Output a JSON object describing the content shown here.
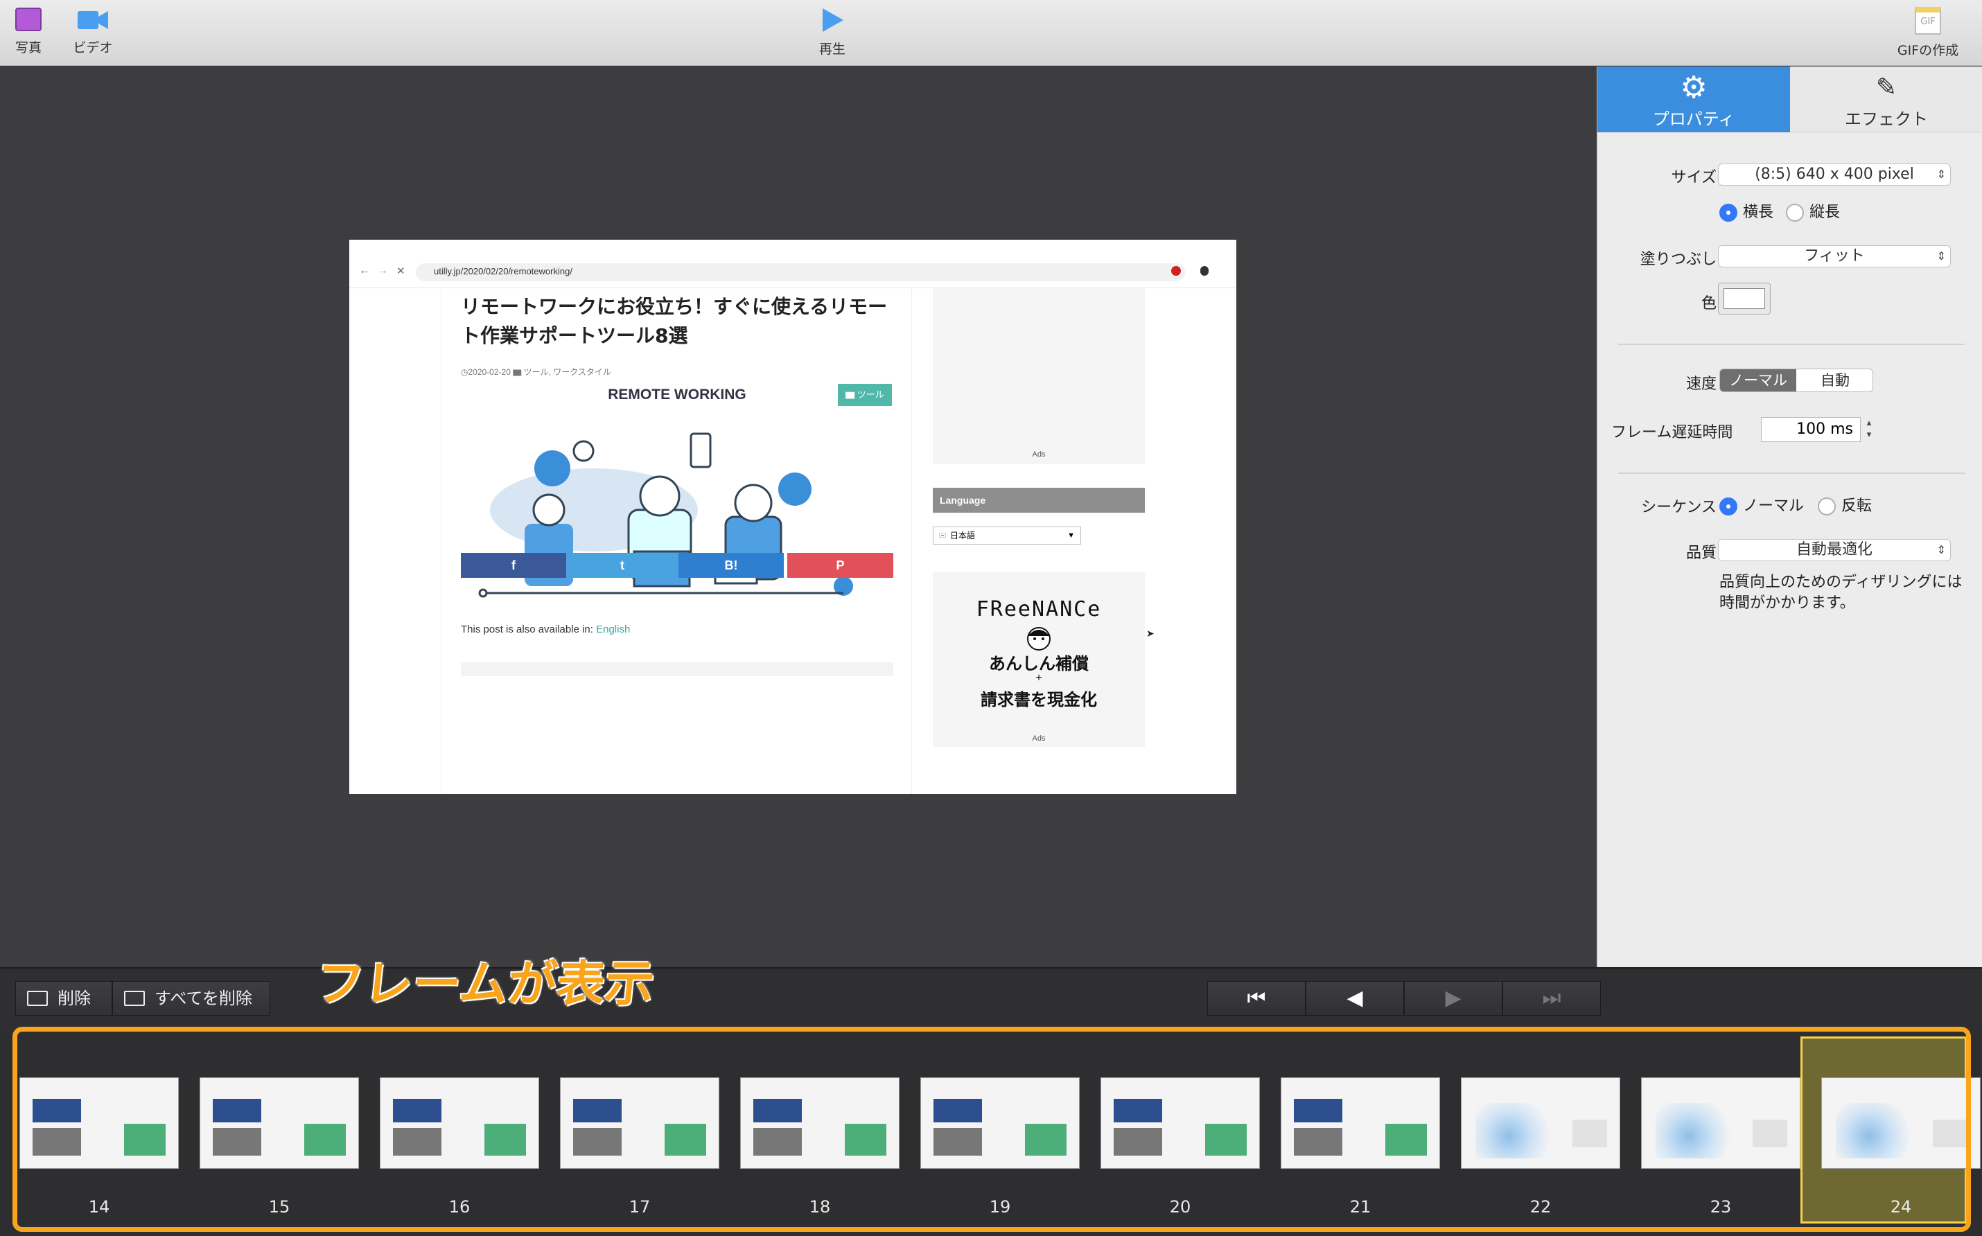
{
  "toolbar": {
    "photo_label": "写真",
    "video_label": "ビデオ",
    "play_label": "再生",
    "gif_label": "GIFの作成",
    "gif_icon_text": "GIF"
  },
  "preview": {
    "url": "utilly.jp/2020/02/20/remoteworking/",
    "article_title": "リモートワークにお役立ち！すぐに使えるリモート作業サポートツール8選",
    "date": "2020-02-20",
    "categories": "ツール, ワークスタイル",
    "category_badge": "ツール",
    "hero_heading": "REMOTE WORKING",
    "share_buttons": [
      "f",
      "t",
      "B!",
      "P"
    ],
    "also_available_text": "This post is also available in:",
    "also_available_link": "English",
    "ads_label": "Ads",
    "language_header": "Language",
    "language_value": "日本語",
    "freenance_brand": "FReeNANCe",
    "freenance_line1": "あんしん補償",
    "freenance_plus": "+",
    "freenance_line2": "請求書を現金化"
  },
  "panel": {
    "tab_properties": "プロパティ",
    "tab_effects": "エフェクト",
    "size_label": "サイズ",
    "size_value": "(8:5) 640 x 400 pixel",
    "orientation_landscape": "横長",
    "orientation_portrait": "縦長",
    "fill_label": "塗りつぶし",
    "fill_value": "フィット",
    "color_label": "色",
    "speed_label": "速度",
    "speed_normal": "ノーマル",
    "speed_auto": "自動",
    "delay_label": "フレーム遅延時間",
    "delay_value": "100 ms",
    "sequence_label": "シーケンス",
    "sequence_normal": "ノーマル",
    "sequence_reverse": "反転",
    "quality_label": "品質",
    "quality_value": "自動最適化",
    "quality_note_1": "品質向上のためのディザリングには",
    "quality_note_2": "時間がかかります。"
  },
  "bottom": {
    "delete_label": "削除",
    "delete_all_label": "すべてを削除",
    "annotation": "フレームが表示"
  },
  "frames": [
    "14",
    "15",
    "16",
    "17",
    "18",
    "19",
    "20",
    "21",
    "22",
    "23",
    "24"
  ],
  "selected_frame": "24",
  "colors": {
    "accent_blue": "#3478f6",
    "annotation_orange": "#f8a51b",
    "selected_frame_fill": "#6e6833"
  }
}
